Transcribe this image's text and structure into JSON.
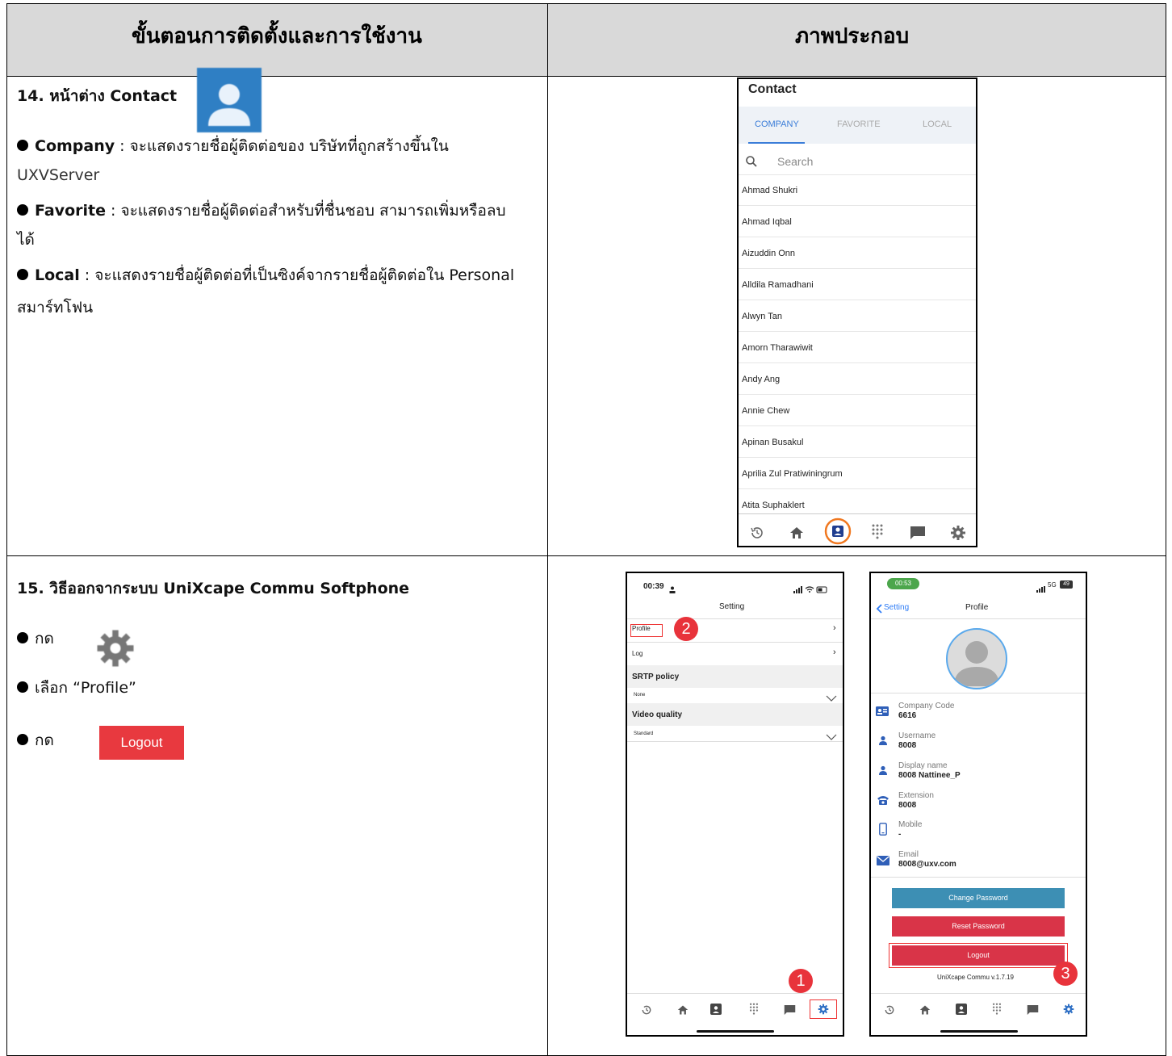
{
  "header": {
    "col1": "ขั้นตอนการติดตั้งและการใช้งาน",
    "col2": "ภาพประกอบ"
  },
  "section14": {
    "title": "14. หน้าต่าง Contact",
    "icon": "contact-icon",
    "b1_label": "Company",
    "b1_text": " : จะแสดงรายชื่อผู้ติดต่อของ บริษัทที่ถูกสร้างขึ้นใน",
    "b1_cont": "UXVServer",
    "b2_label": "Favorite",
    "b2_text": " : จะแสดงรายชื่อผู้ติดต่อสำหรับที่ชื่นชอบ สามารถเพิ่มหรือลบ",
    "b2_cont": "ได้",
    "b3_label": "Local",
    "b3_text": " : จะแสดงรายชื่อผู้ติดต่อที่เป็นซิงค์จากรายชื่อผู้ติดต่อใน Personal",
    "b3_cont": "สมาร์ทโฟน"
  },
  "contact_screen": {
    "title": "Contact",
    "tabs": [
      "COMPANY",
      "FAVORITE",
      "LOCAL"
    ],
    "search_placeholder": "Search",
    "contacts": [
      "Ahmad Shukri",
      "Ahmad Iqbal",
      "Aizuddin Onn",
      "Alldila Ramadhani",
      "Alwyn Tan",
      "Amorn Tharawiwit",
      "Andy Ang",
      "Annie Chew",
      "Apinan Busakul",
      "Aprilia Zul Pratiwiningrum",
      "Atita Suphaklert"
    ],
    "accent_color": "#3b7dd8",
    "highlight_color": "#f07820"
  },
  "section15": {
    "title": "15. วิธีออกจากระบบ UniXcape Commu Softphone",
    "step1": "กด",
    "step1_icon": "gear-icon",
    "step2": "เลือก “Profile”",
    "step3": "กด",
    "logout_label": "Logout"
  },
  "setting_screen": {
    "time": "00:39",
    "title": "Setting",
    "items": [
      "Profile",
      "Log"
    ],
    "srtp_header": "SRTP policy",
    "srtp_value": "None",
    "video_header": "Video quality",
    "video_value": "Standard",
    "badge1": "1",
    "badge2": "2"
  },
  "profile_screen": {
    "time": "00:53",
    "status": "5G",
    "battery": "49",
    "back_label": "Setting",
    "title": "Profile",
    "fields": [
      {
        "label": "Company Code",
        "value": "6616",
        "icon": "id-card-icon"
      },
      {
        "label": "Username",
        "value": "8008",
        "icon": "person-icon"
      },
      {
        "label": "Display name",
        "value": "8008 Nattinee_P",
        "icon": "person-icon"
      },
      {
        "label": "Extension",
        "value": "8008",
        "icon": "phone-icon"
      },
      {
        "label": "Mobile",
        "value": "-",
        "icon": "mobile-icon"
      },
      {
        "label": "Email",
        "value": "8008@uxv.com",
        "icon": "mail-icon"
      }
    ],
    "change_password": "Change Password",
    "reset_password": "Reset Password",
    "logout": "Logout",
    "version": "UniXcape Commu v.1.7.19",
    "badge3": "3",
    "blue_color": "#3d8fb4",
    "red_color": "#d93448"
  }
}
